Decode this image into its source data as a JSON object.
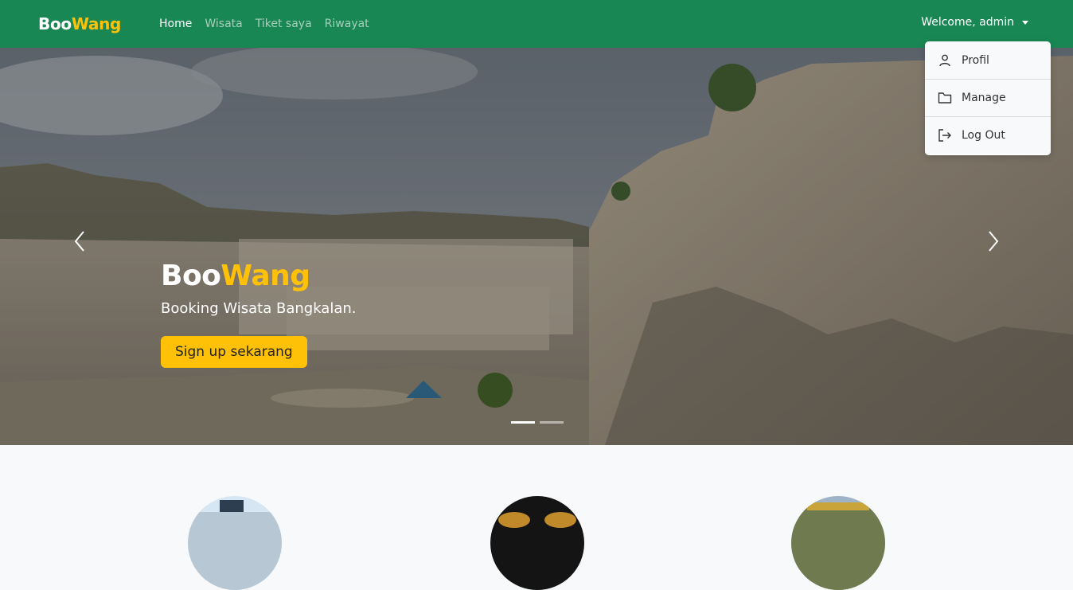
{
  "navbar": {
    "brand_part1": "Boo",
    "brand_part2": "Wang",
    "links": [
      {
        "label": "Home",
        "active": true
      },
      {
        "label": "Wisata",
        "active": false
      },
      {
        "label": "Tiket saya",
        "active": false
      },
      {
        "label": "Riwayat",
        "active": false
      }
    ],
    "user_label": "Welcome, admin"
  },
  "dropdown": {
    "items": [
      {
        "label": "Profil",
        "icon": "person-icon"
      },
      {
        "label": "Manage",
        "icon": "folder-icon"
      },
      {
        "label": "Log Out",
        "icon": "logout-icon"
      }
    ]
  },
  "hero": {
    "title_part1": "Boo",
    "title_part2": "Wang",
    "subtitle": "Booking Wisata Bangkalan.",
    "cta_label": "Sign up sekarang",
    "slide_count": 2,
    "active_slide": 1
  },
  "colors": {
    "navbar": "#198754",
    "accent": "#ffc107"
  }
}
